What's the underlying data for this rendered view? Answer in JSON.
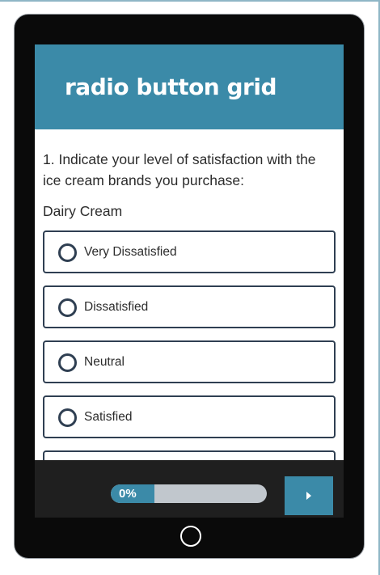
{
  "header": {
    "title": "radio button grid"
  },
  "question": {
    "text": "1. Indicate your level of satisfaction with the ice cream brands you purchase:",
    "row_label": "Dairy Cream"
  },
  "options": [
    {
      "label": "Very Dissatisfied"
    },
    {
      "label": "Dissatisfied"
    },
    {
      "label": "Neutral"
    },
    {
      "label": "Satisfied"
    },
    {
      "label": ""
    }
  ],
  "footer": {
    "progress_text": "0%",
    "progress_value": 0
  },
  "colors": {
    "accent": "#3b8aa8",
    "border": "#2f3f52",
    "footer_bg": "#1f1f1f"
  },
  "icons": {
    "next": "next-arrow-icon",
    "home": "home-button-icon"
  }
}
